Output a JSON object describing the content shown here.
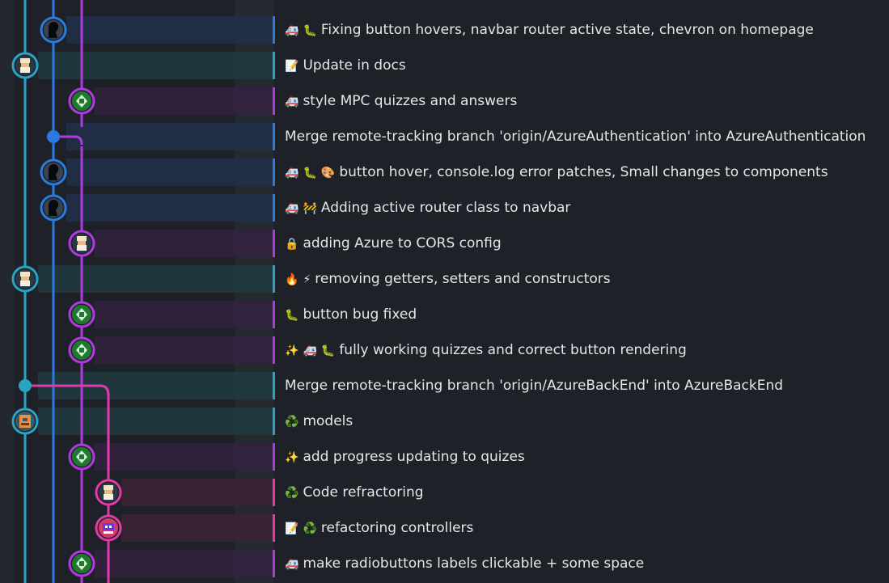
{
  "lane_colors": [
    "#2aa4c4",
    "#2a7ae0",
    "#b03ae0",
    "#e23aa8"
  ],
  "commits": [
    {
      "emoji": [
        "🚑",
        "🐛"
      ],
      "message": "Fixing button hovers, navbar router active state, chevron on homepage",
      "lane": 1,
      "avatar": "black-avatar",
      "marker_color": "#2a7ae0",
      "row_tint": "#1f3048",
      "bar_color": "#2a7ae0"
    },
    {
      "emoji": [
        "📝"
      ],
      "message": "Update in docs",
      "lane": 0,
      "avatar": "bearded-avatar",
      "marker_color": "#2aa4c4",
      "row_tint": "#203840",
      "bar_color": "#2aa4c4"
    },
    {
      "emoji": [
        "🚑"
      ],
      "message": "style MPC quizzes and answers",
      "lane": 2,
      "avatar": "green-avatar",
      "marker_color": "#b03ae0",
      "row_tint": "#33223f",
      "bar_color": "#b03ae0"
    },
    {
      "emoji": [],
      "message": "Merge remote-tracking branch 'origin/AzureAuthentication' into AzureAuthentication",
      "lane": 1,
      "avatar": "merge-dot",
      "marker_color": "#2a7ae0",
      "row_tint": "#1f3048",
      "bar_color": "#2a7ae0"
    },
    {
      "emoji": [
        "🚑",
        "🐛",
        "🎨"
      ],
      "message": "button hover, console.log error patches, Small changes to components",
      "lane": 1,
      "avatar": "black-avatar",
      "marker_color": "#2a7ae0",
      "row_tint": "#1f3048",
      "bar_color": "#2a7ae0"
    },
    {
      "emoji": [
        "🚑",
        "🚧"
      ],
      "message": "Adding active router class to navbar",
      "lane": 1,
      "avatar": "black-avatar",
      "marker_color": "#2a7ae0",
      "row_tint": "#1f3048",
      "bar_color": "#2a7ae0"
    },
    {
      "emoji": [
        "🔒"
      ],
      "message": "adding Azure to CORS config",
      "lane": 2,
      "avatar": "bearded-avatar",
      "marker_color": "#b03ae0",
      "row_tint": "#33223f",
      "bar_color": "#b03ae0"
    },
    {
      "emoji": [
        "🔥",
        "⚡"
      ],
      "message": "removing getters, setters and constructors",
      "lane": 0,
      "avatar": "bearded-avatar",
      "marker_color": "#2aa4c4",
      "row_tint": "#203840",
      "bar_color": "#2aa4c4"
    },
    {
      "emoji": [
        "🐛"
      ],
      "message": "button bug fixed",
      "lane": 2,
      "avatar": "green-avatar",
      "marker_color": "#b03ae0",
      "row_tint": "#33223f",
      "bar_color": "#b03ae0"
    },
    {
      "emoji": [
        "✨",
        "🚑",
        "🐛"
      ],
      "message": "fully working quizzes and correct button rendering",
      "lane": 2,
      "avatar": "green-avatar",
      "marker_color": "#b03ae0",
      "row_tint": "#33223f",
      "bar_color": "#b03ae0"
    },
    {
      "emoji": [],
      "message": "Merge remote-tracking branch 'origin/AzureBackEnd' into AzureBackEnd",
      "lane": 0,
      "avatar": "merge-dot",
      "marker_color": "#2aa4c4",
      "row_tint": "#203840",
      "bar_color": "#2aa4c4"
    },
    {
      "emoji": [
        "♻️"
      ],
      "message": "models",
      "lane": 0,
      "avatar": "orange-avatar",
      "marker_color": "#2aa4c4",
      "row_tint": "#203840",
      "bar_color": "#2aa4c4"
    },
    {
      "emoji": [
        "✨"
      ],
      "message": "add progress updating to quizes",
      "lane": 2,
      "avatar": "green-avatar",
      "marker_color": "#b03ae0",
      "row_tint": "#33223f",
      "bar_color": "#b03ae0"
    },
    {
      "emoji": [
        "♻️"
      ],
      "message": "Code refractoring",
      "lane": 3,
      "avatar": "bearded-avatar",
      "marker_color": "#e23aa8",
      "row_tint": "#3a2234",
      "bar_color": "#e23aa8"
    },
    {
      "emoji": [
        "📝",
        "♻️"
      ],
      "message": "refactoring controllers",
      "lane": 3,
      "avatar": "red-avatar",
      "marker_color": "#e23aa8",
      "row_tint": "#3a2234",
      "bar_color": "#e23aa8"
    },
    {
      "emoji": [
        "🚑"
      ],
      "message": "make radiobuttons labels clickable + some space",
      "lane": 2,
      "avatar": "green-avatar",
      "marker_color": "#b03ae0",
      "row_tint": "#33223f",
      "bar_color": "#b03ae0"
    }
  ]
}
